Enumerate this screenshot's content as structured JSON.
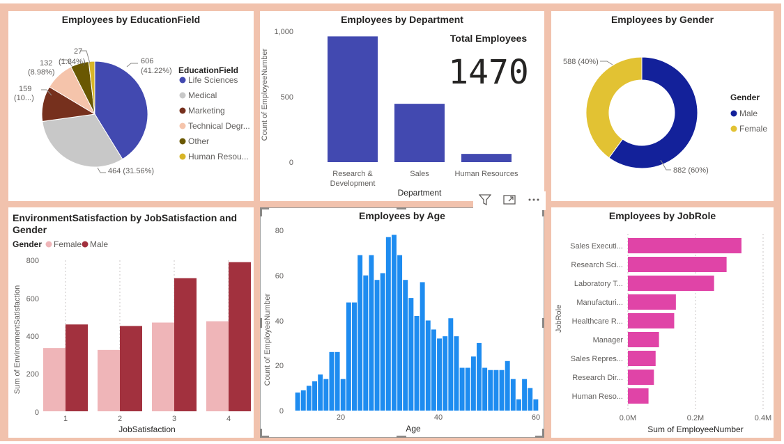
{
  "colors": {
    "background": "#f1c2ad",
    "panel": "#ffffff",
    "education": [
      "#4249b0",
      "#c8c8c8",
      "#76301d",
      "#f5c4ab",
      "#6a5802",
      "#d8b527"
    ],
    "department_bar": "#4249b0",
    "gender_male": "#13219a",
    "gender_female": "#e2c233",
    "satisfaction_female": "#efb5b8",
    "satisfaction_male": "#a2313e",
    "age_bar": "#1e8cf0",
    "jobrole_bar": "#e044a7"
  },
  "education_panel": {
    "title": "Employees by EducationField",
    "legend_title": "EducationField",
    "legend_items": [
      "Life Sciences",
      "Medical",
      "Marketing",
      "Technical Degr...",
      "Other",
      "Human Resou..."
    ],
    "slice_labels": [
      {
        "value": "606",
        "pct": "(41.22%)"
      },
      {
        "value": "464 (31.56%)",
        "pct": ""
      },
      {
        "value": "159",
        "pct": "(10...)"
      },
      {
        "value": "132",
        "pct": "(8.98%)"
      },
      {
        "value": "27",
        "pct": "(1.84%)"
      }
    ]
  },
  "department_panel": {
    "title": "Employees by Department",
    "ylabel": "Count of EmployeeNumber",
    "xlabel": "Department",
    "yticks": [
      "1,000",
      "500",
      "0"
    ],
    "categories": [
      "Research &",
      "Development",
      "Sales",
      "Human Resources"
    ],
    "card_title": "Total Employees",
    "card_value": "1470"
  },
  "gender_panel": {
    "title": "Employees by Gender",
    "legend_title": "Gender",
    "legend_items": [
      "Male",
      "Female"
    ],
    "label_female": "588 (40%)",
    "label_male": "882 (60%)"
  },
  "satisfaction_panel": {
    "title_line1": "EnvironmentSatisfaction by JobSatisfaction and",
    "title_line2": "Gender",
    "legend_title": "Gender",
    "legend_items": [
      "Female",
      "Male"
    ],
    "ylabel": "Sum of EnvironmentSatisfaction",
    "xlabel": "JobSatisfaction",
    "yticks": [
      "800",
      "600",
      "400",
      "200",
      "0"
    ],
    "xticks": [
      "1",
      "2",
      "3",
      "4"
    ]
  },
  "age_panel": {
    "title": "Employees by Age",
    "ylabel": "Count of EmployeeNumber",
    "xlabel": "Age",
    "yticks": [
      "80",
      "60",
      "40",
      "20",
      "0"
    ],
    "xticks": [
      "20",
      "40",
      "60"
    ]
  },
  "jobrole_panel": {
    "title": "Employees by JobRole",
    "ylabel": "JobRole",
    "xlabel": "Sum of EmployeeNumber",
    "xticks": [
      "0.0M",
      "0.2M",
      "0.4M"
    ]
  },
  "chart_data": [
    {
      "type": "pie",
      "title": "Employees by EducationField",
      "categories": [
        "Life Sciences",
        "Medical",
        "Marketing",
        "Technical Degree",
        "Other",
        "Human Resources"
      ],
      "values": [
        606,
        464,
        159,
        132,
        82,
        27
      ]
    },
    {
      "type": "bar",
      "title": "Employees by Department",
      "xlabel": "Department",
      "ylabel": "Count of EmployeeNumber",
      "categories": [
        "Research & Development",
        "Sales",
        "Human Resources"
      ],
      "values": [
        961,
        446,
        63
      ],
      "ylim": [
        0,
        1000
      ]
    },
    {
      "type": "pie",
      "title": "Employees by Gender",
      "categories": [
        "Male",
        "Female"
      ],
      "values": [
        882,
        588
      ]
    },
    {
      "type": "bar",
      "title": "EnvironmentSatisfaction by JobSatisfaction and Gender",
      "xlabel": "JobSatisfaction",
      "ylabel": "Sum of EnvironmentSatisfaction",
      "categories": [
        "1",
        "2",
        "3",
        "4"
      ],
      "series": [
        {
          "name": "Female",
          "values": [
            335,
            325,
            470,
            477
          ]
        },
        {
          "name": "Male",
          "values": [
            460,
            452,
            705,
            790
          ]
        }
      ],
      "ylim": [
        0,
        800
      ]
    },
    {
      "type": "bar",
      "title": "Employees by Age",
      "xlabel": "Age",
      "ylabel": "Count of EmployeeNumber",
      "x": [
        18,
        19,
        20,
        21,
        22,
        23,
        24,
        25,
        26,
        27,
        28,
        29,
        30,
        31,
        32,
        33,
        34,
        35,
        36,
        37,
        38,
        39,
        40,
        41,
        42,
        43,
        44,
        45,
        46,
        47,
        48,
        49,
        50,
        51,
        52,
        53,
        54,
        55,
        56,
        57,
        58,
        59,
        60
      ],
      "values": [
        8,
        9,
        11,
        13,
        16,
        14,
        26,
        26,
        14,
        48,
        48,
        69,
        60,
        69,
        58,
        61,
        77,
        78,
        69,
        58,
        50,
        42,
        57,
        40,
        36,
        32,
        33,
        41,
        33,
        19,
        19,
        24,
        30,
        19,
        18,
        18,
        18,
        22,
        14,
        5,
        14,
        10,
        5
      ],
      "xlim": [
        17,
        61
      ],
      "ylim": [
        0,
        80
      ]
    },
    {
      "type": "bar",
      "title": "Employees by JobRole",
      "xlabel": "Sum of EmployeeNumber",
      "ylabel": "JobRole",
      "categories": [
        "Sales Executi...",
        "Research Sci...",
        "Laboratory T...",
        "Manufacturi...",
        "Healthcare R...",
        "Manager",
        "Sales Repres...",
        "Research Dir...",
        "Human Reso..."
      ],
      "values": [
        0.336,
        0.292,
        0.255,
        0.142,
        0.137,
        0.092,
        0.082,
        0.077,
        0.061
      ],
      "xlim": [
        0,
        0.4
      ]
    }
  ]
}
